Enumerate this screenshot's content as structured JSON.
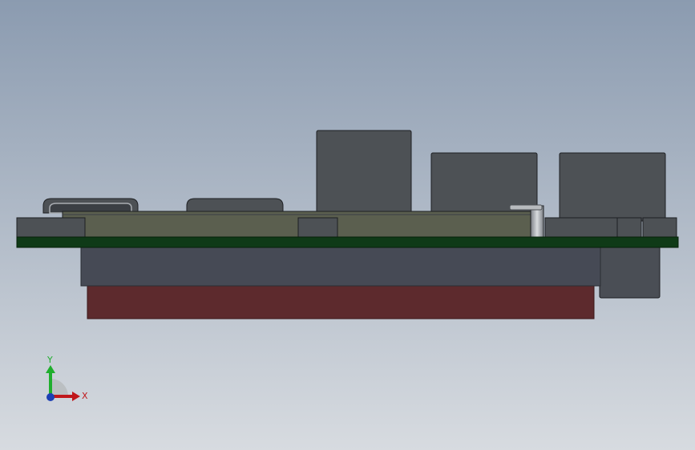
{
  "viewport": {
    "background_top": "#8b9bb0",
    "background_bottom": "#d7dbe0"
  },
  "model": {
    "colors": {
      "pcb": "#0f3a17",
      "pcb_edge": "#062008",
      "module_body": "#5b5f4f",
      "connector_gray": "#4d5155",
      "connector_dark": "#3b3f44",
      "heatsink": "#464a55",
      "heatsink_edge": "#2a2d33",
      "thermal_pad": "#5d2a2d",
      "thermal_pad_edge": "#3a1819",
      "housing_right": "#4a4e55",
      "outline": "#1d1f22",
      "shine": "#a9adb2"
    }
  },
  "triad": {
    "x_label": "X",
    "y_label": "Y",
    "x_color": "#c0171b",
    "y_color": "#1fae2d",
    "z_color": "#1c3fb4",
    "arc_color": "#b9bcbf"
  }
}
